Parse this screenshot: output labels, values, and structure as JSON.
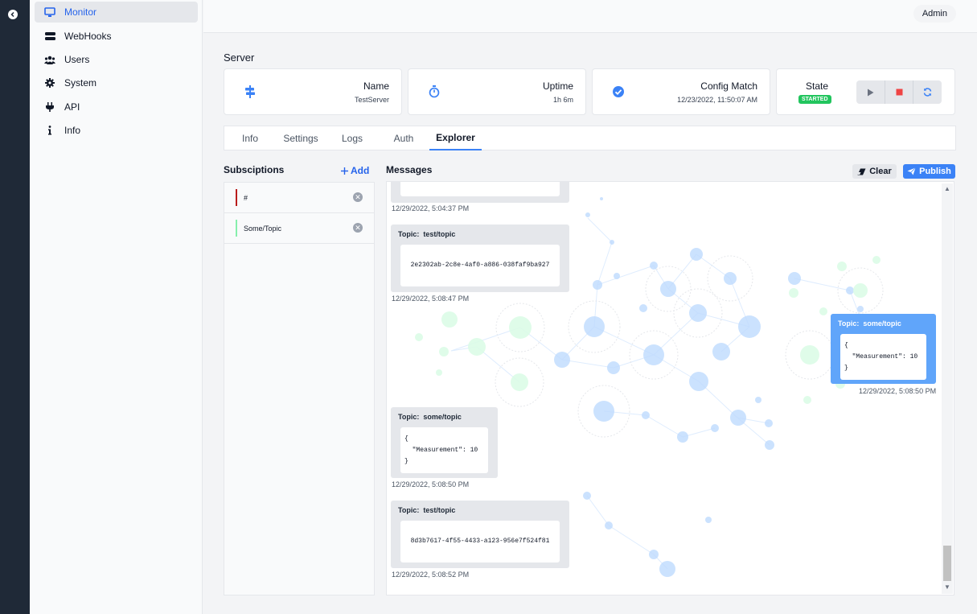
{
  "sidebar": {
    "items": [
      {
        "label": "Monitor",
        "icon": "monitor-icon"
      },
      {
        "label": "WebHooks",
        "icon": "server-icon"
      },
      {
        "label": "Users",
        "icon": "users-icon"
      },
      {
        "label": "System",
        "icon": "gear-icon"
      },
      {
        "label": "API",
        "icon": "plug-icon"
      },
      {
        "label": "Info",
        "icon": "info-icon"
      }
    ]
  },
  "header": {
    "user_label": "Admin"
  },
  "server": {
    "title": "Server",
    "name_label": "Name",
    "name_value": "TestServer",
    "uptime_label": "Uptime",
    "uptime_value": "1h 6m",
    "config_label": "Config Match",
    "config_value": "12/23/2022, 11:50:07 AM",
    "state_label": "State",
    "state_value": "STARTED"
  },
  "tabs": [
    "Info",
    "Settings",
    "Logs",
    "Auth",
    "Explorer"
  ],
  "subscriptions": {
    "title": "Subsciptions",
    "add_label": "Add",
    "items": [
      {
        "label": "#",
        "color": "#b91c1c"
      },
      {
        "label": "Some/Topic",
        "color": "#86efac"
      }
    ]
  },
  "messages": {
    "title": "Messages",
    "clear_label": "Clear",
    "publish_label": "Publish",
    "topic_prefix": "Topic:",
    "items": [
      {
        "time": "12/29/2022, 5:04:37 PM"
      },
      {
        "topic": "test/topic",
        "payload": "2e2302ab-2c8e-4af0-a886-038faf9ba927",
        "time": "12/29/2022, 5:08:47 PM"
      },
      {
        "topic": "some/topic",
        "payload_lines": [
          "{",
          "  \"Measurement\": 10",
          "}"
        ],
        "time": "12/29/2022, 5:08:50 PM"
      },
      {
        "topic": "some/topic",
        "payload_lines": [
          "{",
          "  \"Measurement\": 10",
          "}"
        ],
        "time": "12/29/2022, 5:08:50 PM"
      },
      {
        "topic": "test/topic",
        "payload": "8d3b7617-4f55-4433-a123-956e7f524f81",
        "time": "12/29/2022, 5:08:52 PM"
      }
    ]
  },
  "colors": {
    "accent": "#3b82f6",
    "started": "#22c55e",
    "stop": "#ef4444"
  }
}
